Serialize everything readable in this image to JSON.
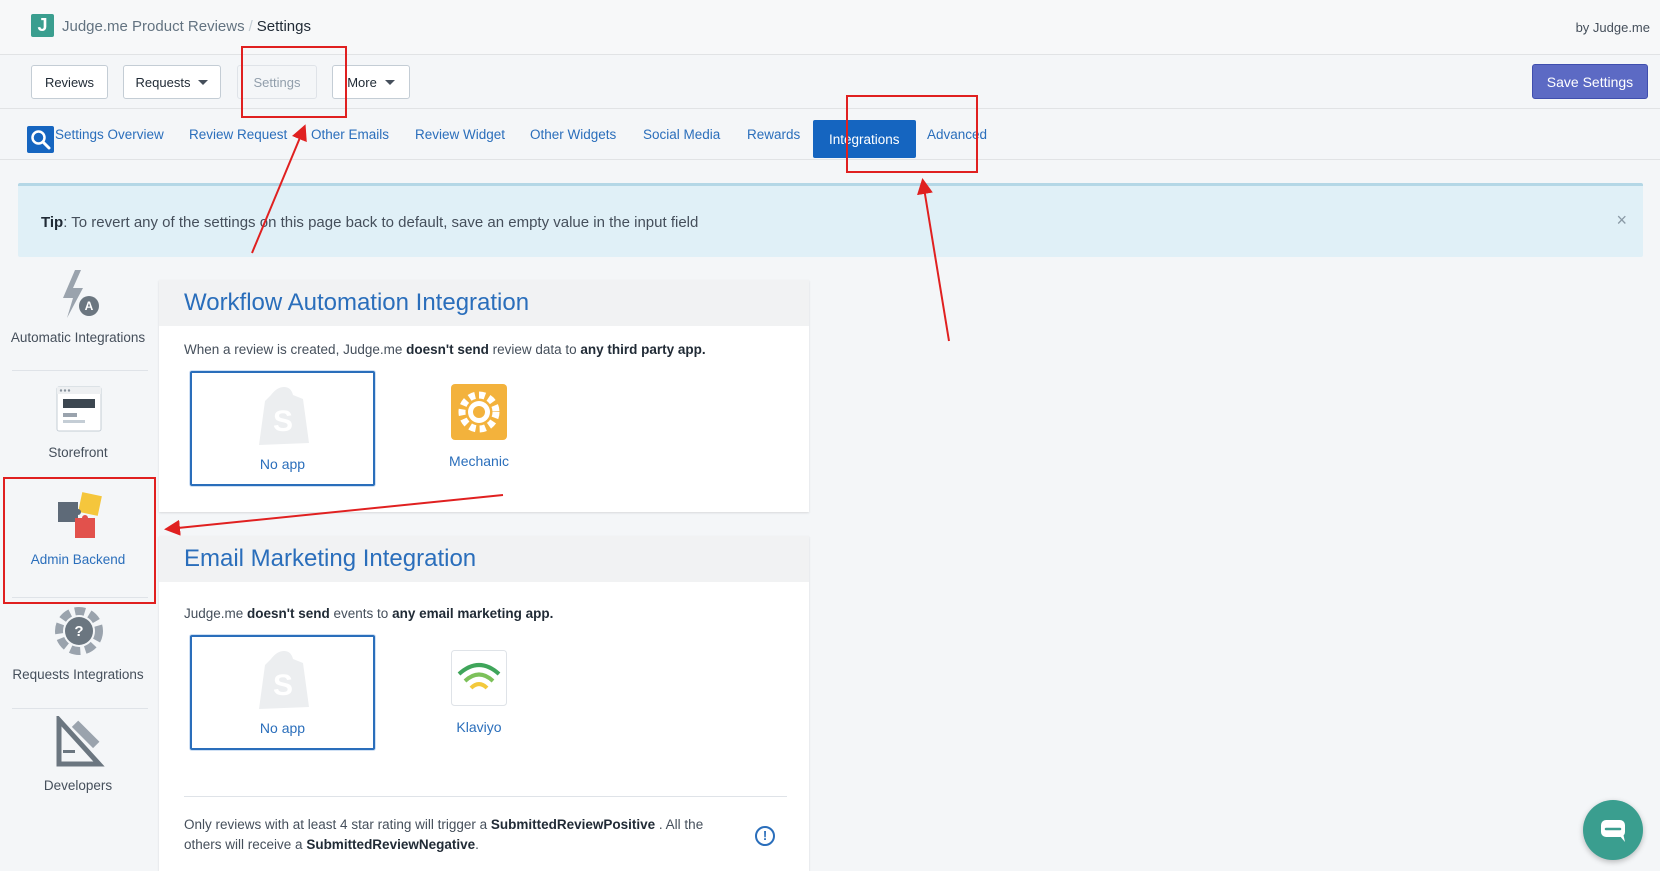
{
  "header": {
    "app_name": "Judge.me Product Reviews",
    "separator": "/",
    "current": "Settings",
    "byline": "by Judge.me",
    "logo_letter": "J"
  },
  "toolbar": {
    "reviews": "Reviews",
    "requests": "Requests",
    "settings": "Settings",
    "more": "More",
    "save": "Save Settings"
  },
  "tabs": [
    {
      "label": "Settings Overview"
    },
    {
      "label": "Review Request"
    },
    {
      "label": "Other Emails"
    },
    {
      "label": "Review Widget"
    },
    {
      "label": "Other Widgets"
    },
    {
      "label": "Social Media"
    },
    {
      "label": "Rewards"
    },
    {
      "label": "Integrations"
    },
    {
      "label": "Advanced"
    }
  ],
  "tip": {
    "bold": "Tip",
    "text": ": To revert any of the settings on this page back to default, save an empty value in the input field",
    "close": "×"
  },
  "sidebar": [
    {
      "label": "Automatic Integrations",
      "icon": "lightning-a-icon"
    },
    {
      "label": "Storefront",
      "icon": "storefront-icon"
    },
    {
      "label": "Admin Backend",
      "icon": "puzzle-icon"
    },
    {
      "label": "Requests Integrations",
      "icon": "help-gear-icon"
    },
    {
      "label": "Developers",
      "icon": "tools-icon"
    }
  ],
  "workflow": {
    "title": "Workflow Automation Integration",
    "desc_1": "When a review is created, Judge.me ",
    "desc_b1": "doesn't send",
    "desc_2": " review data to ",
    "desc_b2": "any third party app.",
    "no_app": "No app",
    "app": "Mechanic"
  },
  "email": {
    "title": "Email Marketing Integration",
    "desc_1": "Judge.me ",
    "desc_b1": "doesn't send",
    "desc_2": " events to ",
    "desc_b2": "any email marketing app.",
    "no_app": "No app",
    "app": "Klaviyo",
    "note_1": "Only reviews with at least 4 star rating will trigger a ",
    "note_b1": "SubmittedReviewPositive",
    "note_2": " . All the others will receive a ",
    "note_b2": "SubmittedReviewNegative",
    "note_3": ".",
    "info": "!"
  },
  "colors": {
    "accent": "#2a6ebb",
    "active_tab": "#1565c0",
    "save": "#5c6ac4",
    "annotation": "#e02020",
    "chat": "#3a9e8f"
  }
}
